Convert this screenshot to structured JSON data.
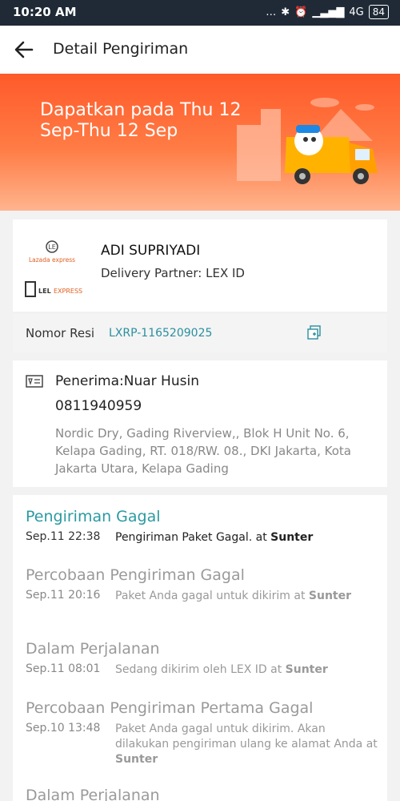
{
  "status_bar": {
    "time": "10:20 AM",
    "network": "4G",
    "battery": "84"
  },
  "app_bar": {
    "title": "Detail Pengiriman"
  },
  "banner": {
    "text": "Dapatkan pada Thu 12 Sep-Thu 12 Sep"
  },
  "partner": {
    "logo1_text": "Lazada express",
    "logo2_text": "LELEXPRESS",
    "recipient_name": "ADI SUPRIYADI",
    "delivery_partner": "Delivery Partner: LEX ID"
  },
  "resi": {
    "label": "Nomor Resi",
    "value": "LXRP-1165209025"
  },
  "address": {
    "receiver": "Penerima:Nuar Husin",
    "phone": "0811940959",
    "full": "Nordic Dry, Gading Riverview,, Blok H Unit No. 6, Kelapa Gading, RT. 018/RW. 08., DKI Jakarta, Kota Jakarta Utara, Kelapa Gading"
  },
  "timeline": [
    {
      "title": "Pengiriman Gagal",
      "time": "Sep.11 22:38",
      "desc": "Pengiriman Paket Gagal.  at ",
      "location": "Sunter"
    },
    {
      "title": "Percobaan Pengiriman Gagal",
      "time": "Sep.11 20:16",
      "desc": "Paket Anda gagal untuk dikirim  at ",
      "location": "Sunter"
    },
    {
      "title": "Dalam Perjalanan",
      "time": "Sep.11 08:01",
      "desc": "Sedang dikirim oleh LEX ID at ",
      "location": "Sunter"
    },
    {
      "title": "Percobaan Pengiriman Pertama Gagal",
      "time": "Sep.10 13:48",
      "desc": "Paket Anda gagal untuk dikirim. Akan dilakukan pengiriman ulang ke alamat Anda at ",
      "location": "Sunter"
    },
    {
      "title": "Dalam Perjalanan",
      "time": "",
      "desc": "",
      "location": ""
    }
  ]
}
